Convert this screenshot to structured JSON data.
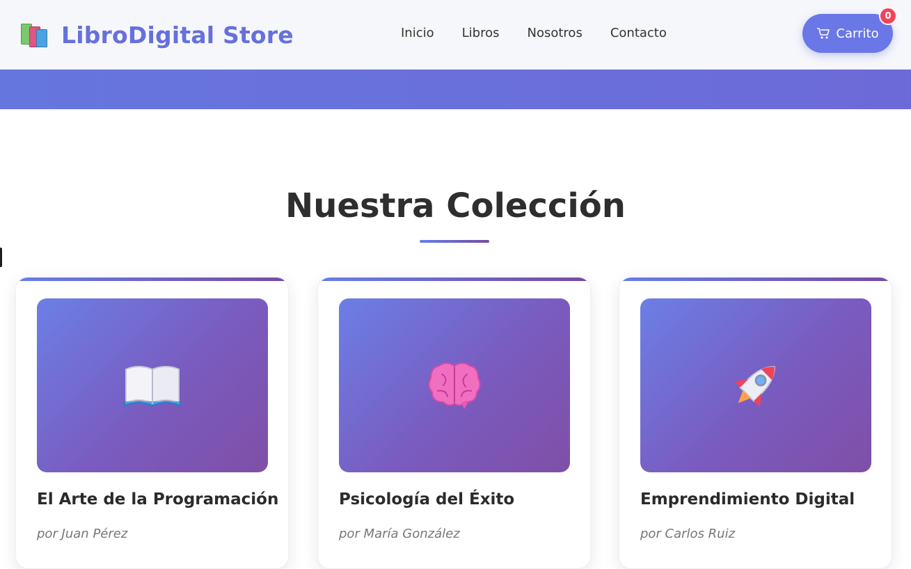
{
  "header": {
    "brand": "LibroDigital Store",
    "logo_icon": "books-icon",
    "nav": [
      "Inicio",
      "Libros",
      "Nosotros",
      "Contacto"
    ],
    "cart_label": "Carrito",
    "cart_icon": "cart-icon",
    "cart_count": "0"
  },
  "colors": {
    "accent": "#6670dd",
    "gradient_start": "#667eea",
    "gradient_end": "#764ba2",
    "badge": "#f0445a"
  },
  "section": {
    "title": "Nuestra Colección"
  },
  "books": [
    {
      "icon": "open-book-icon",
      "title": "El Arte de la Programación",
      "author": "por Juan Pérez"
    },
    {
      "icon": "brain-icon",
      "title": "Psicología del Éxito",
      "author": "por María González"
    },
    {
      "icon": "rocket-icon",
      "title": "Emprendimiento Digital",
      "author": "por Carlos Ruiz"
    }
  ]
}
